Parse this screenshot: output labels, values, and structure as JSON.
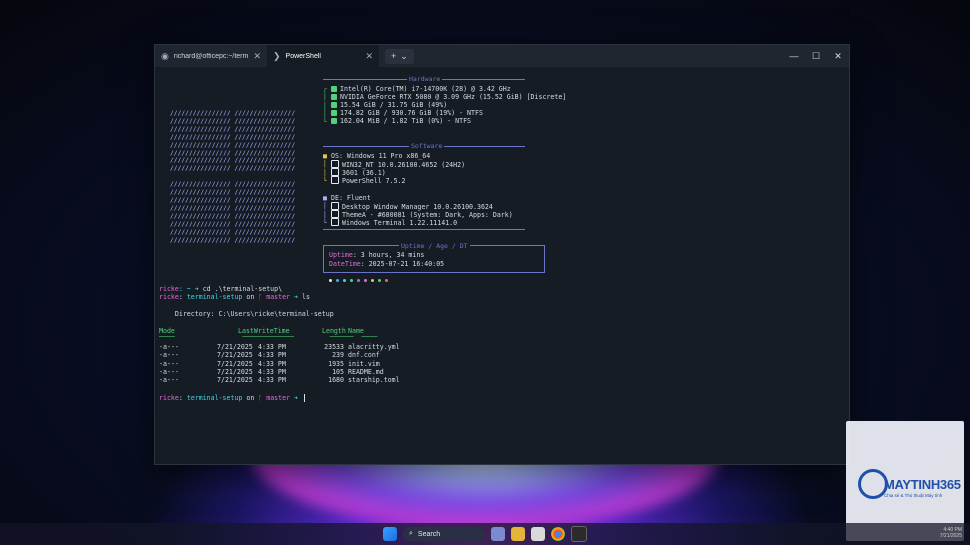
{
  "window": {
    "tabs": [
      {
        "label": "richard@officepc:~/terminal-s"
      },
      {
        "label": "PowerShell"
      }
    ],
    "new_tab": "+",
    "dropdown": "⌄",
    "minimize": "—",
    "maximize": "☐",
    "close": "✕",
    "tab_close": "✕"
  },
  "fastfetch": {
    "hardware_title": "Hardware",
    "hardware": [
      "Intel(R) Core(TM) i7-14700K (28) @ 3.42 GHz",
      "NVIDIA GeForce RTX 5080 @ 3.09 GHz (15.52 GiB) [Discrete]",
      "15.54 GiB / 31.75 GiB (49%)",
      "174.82 GiB / 930.76 GiB (19%) - NTFS",
      "162.04 MiB / 1.82 TiB (0%) - NTFS"
    ],
    "software_title": "Software",
    "software": [
      "OS: Windows 11 Pro x86_64",
      "WIN32_NT 10.0.26100.4652 (24H2)",
      "3601 (36.1)",
      "PowerShell 7.5.2"
    ],
    "de": [
      "DE: Fluent",
      "Desktop Window Manager 10.0.26100.3624",
      "ThemeA - #680081 (System: Dark, Apps: Dark)",
      "Windows Terminal 1.22.11141.0"
    ],
    "uptime_title": "Uptime / Age / DT",
    "uptime_label": "Uptime",
    "uptime_value": ": 3 hours, 34 mins",
    "datetime_label": "DateTime",
    "datetime_value": ": 2025-07-21 16:40:05"
  },
  "session": {
    "line1_user": "ricke",
    "line1_sep": ": ~ ➜ ",
    "line1_cmd": "cd .\\terminal-setup\\",
    "line2_user": "ricke",
    "line2_dir": "terminal-setup",
    "line2_on": " on ",
    "line2_branch": "master",
    "line2_arrow": " ➜ ",
    "line2_cmd": "ls",
    "directory": "    Directory: C:\\Users\\ricke\\terminal-setup",
    "headers": {
      "mode": "Mode",
      "lwt": "LastWriteTime",
      "length": "Length",
      "name": "Name"
    },
    "rows": [
      {
        "mode": "-a---",
        "date": "7/21/2025",
        "time": "4:33 PM",
        "length": "23533",
        "name": "alacritty.yml"
      },
      {
        "mode": "-a---",
        "date": "7/21/2025",
        "time": "4:33 PM",
        "length": "239",
        "name": "dnf.conf"
      },
      {
        "mode": "-a---",
        "date": "7/21/2025",
        "time": "4:33 PM",
        "length": "1935",
        "name": "init.vim"
      },
      {
        "mode": "-a---",
        "date": "7/21/2025",
        "time": "4:33 PM",
        "length": "105",
        "name": "README.md"
      },
      {
        "mode": "-a---",
        "date": "7/21/2025",
        "time": "4:33 PM",
        "length": "1680",
        "name": "starship.toml"
      }
    ],
    "prompt_user": "ricke",
    "prompt_dir": "terminal-setup",
    "prompt_on": " on ",
    "prompt_branch": "master",
    "prompt_arrow": " ➜ "
  },
  "taskbar": {
    "search_label": "Search"
  },
  "tray": {
    "time": "4:40 PM",
    "date": "7/21/2025"
  },
  "watermark": {
    "brand": "MAYTINH365",
    "tagline": "Chia sẻ & Thủ thuật Máy tính"
  },
  "colors": {
    "accent": "#6b74c9",
    "prompt_cyan": "#3fd4e8",
    "green": "#4ed27a",
    "pink": "#e46ad8"
  }
}
